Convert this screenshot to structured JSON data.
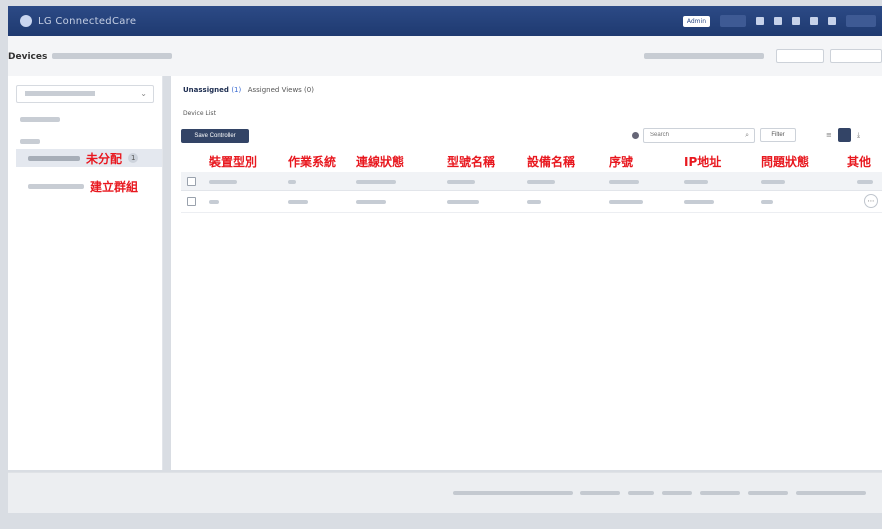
{
  "app": {
    "title": "LG ConnectedCare"
  },
  "topbar": {
    "admin_badge": "Admin"
  },
  "header": {
    "title": "Devices"
  },
  "sidebar": {
    "unassigned_label": "未分配",
    "unassigned_count": "1",
    "create_group_label": "建立群組"
  },
  "main": {
    "title": "Unassigned",
    "count": "(1)",
    "second": "Assigned Views (0)",
    "list_title": "Device List",
    "create_button": "Save Controller",
    "search_placeholder": "Search",
    "filter_label": "Filter"
  },
  "table": {
    "columns": [
      "裝置型別",
      "作業系統",
      "連線狀態",
      "型號名稱",
      "設備名稱",
      "序號",
      "IP地址",
      "問題狀態",
      "其他"
    ]
  },
  "colors": {
    "topbar": "#243f7a",
    "accent": "#e8181f",
    "primary_button": "#334466"
  }
}
